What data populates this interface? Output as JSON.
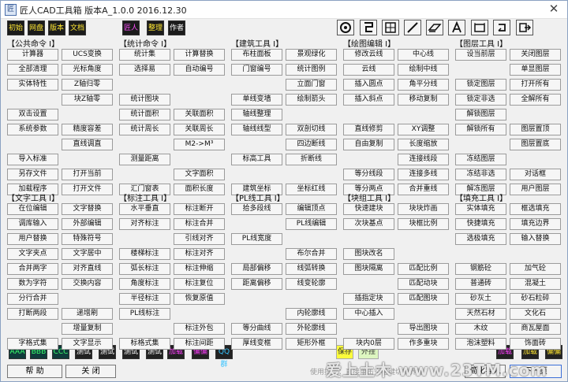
{
  "window": {
    "title": "匠人CAD工具箱 版本A_1.0.0 2016.12.30",
    "close_glyph": "✕",
    "app_icon_glyph": "匠"
  },
  "toolbar": {
    "tags": [
      "初始",
      "网盘",
      "版本",
      "文档",
      "匠人",
      "整理",
      "作者"
    ],
    "icons": [
      "gear-icon",
      "spiral-icon",
      "grid-icon",
      "diagonal-line-icon",
      "layers-icon",
      "text-a-icon",
      "frame-icon",
      "rotate-icon",
      "export-icon"
    ]
  },
  "sections": [
    {
      "title": "【公共命令 I】",
      "buttons": [
        "计算器",
        "UCS变换",
        "全部清理",
        "光标角度",
        "实体特性",
        "Z轴归零",
        "",
        "块Z轴零",
        "双击设置",
        "",
        "系统参数",
        "精度容差",
        "",
        "直线调直",
        "导入标准",
        "",
        "另存文件",
        "打开当前",
        "加载程序",
        "打开文件"
      ]
    },
    {
      "title": "【统计命令 I】",
      "buttons": [
        "统计集",
        "计算替换",
        "选择易",
        "自动编号",
        "",
        "",
        "统计图块",
        "",
        "统计面积",
        "关联面积",
        "统计周长",
        "关联周长",
        "",
        "M2->M³",
        "测量距离",
        "",
        "",
        "文字面积",
        "汇门窗表",
        "面积长度"
      ]
    },
    {
      "title": "【建筑工具 I】",
      "buttons": [
        "布柱面板",
        "景观绿化",
        "门窗编号",
        "统计图例",
        "",
        "立面门窗",
        "单线变墙",
        "绘制箭头",
        "轴线整理",
        "",
        "轴线线型",
        "双剖切线",
        "",
        "四边断线",
        "标高工具",
        "折断线",
        "",
        "",
        "建筑坐标",
        "坐标红线"
      ]
    },
    {
      "title": "【绘图编辑 I】",
      "buttons": [
        "修改云线",
        "中心线",
        "云线",
        "绘制中线",
        "插入圆点",
        "角平分线",
        "插入斜点",
        "移动复制",
        "",
        "",
        "直线修剪",
        "XY调整",
        "自由复制",
        "长度缩放",
        "",
        "连接线段",
        "等分线段",
        "连接多线",
        "等分两点",
        "合并重线"
      ]
    },
    {
      "title": "【图层工具 I】",
      "buttons": [
        "设当前层",
        "关闭图层",
        "",
        "单显图层",
        "锁定图层",
        "打开所有",
        "锁定非选",
        "全解所有",
        "解锁图层",
        "",
        "解锁所有",
        "图层置顶",
        "",
        "图层置底",
        "冻结图层",
        "",
        "冻结非选",
        "对话框",
        "解冻图层",
        "用户图层"
      ]
    },
    {
      "title": "【文字工具 I】",
      "buttons": [
        "在位编辑",
        "文字替换",
        "调库输入",
        "外部编辑",
        "用户替换",
        "特殊符号",
        "文字夹点",
        "文字居中",
        "合并两字",
        "对齐直线",
        "数为字符",
        "交换内容",
        "分行合并",
        "",
        "打断两段",
        "递增刷",
        "",
        "增量复制",
        "字格式集",
        "文字显示"
      ]
    },
    {
      "title": "【标注工具 I】",
      "buttons": [
        "水平垂直",
        "标注断开",
        "对齐标注",
        "标注合并",
        "",
        "引线对齐",
        "楼梯标注",
        "标注对齐",
        "弧长标注",
        "标注伸缩",
        "角度标注",
        "标注复位",
        "半径标注",
        "恢复原值",
        "PL线标注",
        "",
        "",
        "标注外包",
        "标格式集",
        "标注间距"
      ]
    },
    {
      "title": "【PL线工具 I】",
      "buttons": [
        "拾多段线",
        "编辑顶点",
        "",
        "PL线编辑",
        "PL线宽度",
        "",
        "",
        "布尔合并",
        "局部偏移",
        "线弧转换",
        "距离偏移",
        "线变轮廓",
        "",
        "",
        "",
        "内轮廓线",
        "等分曲线",
        "外轮廓线",
        "厚线变框",
        "矩形外框"
      ]
    },
    {
      "title": "【块组工具 I】",
      "buttons": [
        "快速建块",
        "块块炸画",
        "次块基点",
        "块框比例",
        "",
        "",
        "图块改名",
        "",
        "图块隔离",
        "匹配比例",
        "",
        "匹配动块",
        "插指定块",
        "匹配图块",
        "中心插入",
        "",
        "",
        "导出图块",
        "块内0层",
        "作多重块"
      ]
    },
    {
      "title": "【填充工具 I】",
      "buttons": [
        "实体填充",
        "框选填充",
        "快捷填充",
        "填充边界",
        "选极填充",
        "输入替换",
        "",
        "",
        "钢筋砼",
        "加气砼",
        "普通砖",
        "混凝土",
        "砂灰土",
        "砂石粒碎",
        "天然石材",
        "文化石",
        "木纹",
        "商瓦屋面",
        "泡沫塑料",
        "饰面砖"
      ]
    }
  ],
  "bottom_tags": [
    "AAA",
    "BBB",
    "CCC",
    "测试",
    "测试",
    "测试",
    "测试",
    "加载",
    "偏偏",
    "QQ群",
    "保存",
    "外挂",
    "加载",
    "加载",
    "偏偏"
  ],
  "footer": {
    "help": "帮  助",
    "close": "关  闭",
    "usage_text": "使用提示：直接单击空格键切换界面",
    "simplify_import": "简化导入",
    "next_page": "下一页",
    "watermark": "爱上土木 www.23TM.com"
  }
}
